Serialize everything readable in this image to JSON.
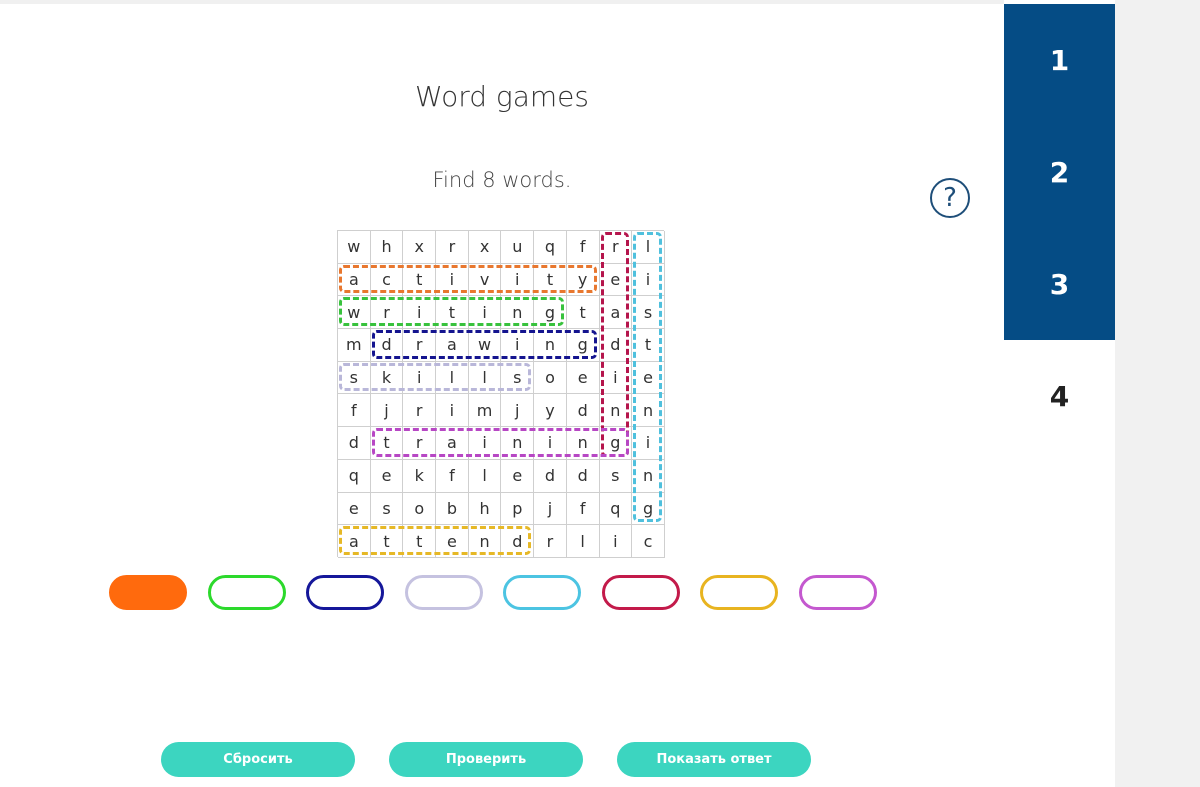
{
  "game": {
    "title": "Word games",
    "instruction": "Find 8 words.",
    "help_symbol": "?"
  },
  "grid": {
    "rows": [
      [
        "w",
        "h",
        "x",
        "r",
        "x",
        "u",
        "q",
        "f",
        "r",
        "l"
      ],
      [
        "a",
        "c",
        "t",
        "i",
        "v",
        "i",
        "t",
        "y",
        "e",
        "i"
      ],
      [
        "w",
        "r",
        "i",
        "t",
        "i",
        "n",
        "g",
        "t",
        "a",
        "s"
      ],
      [
        "m",
        "d",
        "r",
        "a",
        "w",
        "i",
        "n",
        "g",
        "d",
        "t"
      ],
      [
        "s",
        "k",
        "i",
        "l",
        "l",
        "s",
        "o",
        "e",
        "i",
        "e"
      ],
      [
        "f",
        "j",
        "r",
        "i",
        "m",
        "j",
        "y",
        "d",
        "n",
        "n"
      ],
      [
        "d",
        "t",
        "r",
        "a",
        "i",
        "n",
        "i",
        "n",
        "g",
        "i"
      ],
      [
        "q",
        "e",
        "k",
        "f",
        "l",
        "e",
        "d",
        "d",
        "s",
        "n"
      ],
      [
        "e",
        "s",
        "o",
        "b",
        "h",
        "p",
        "j",
        "f",
        "q",
        "g"
      ],
      [
        "a",
        "t",
        "t",
        "e",
        "n",
        "d",
        "r",
        "l",
        "i",
        "c"
      ]
    ]
  },
  "found_words": [
    {
      "word": "activity",
      "color": "#e8772e",
      "row": 1,
      "col": 0,
      "dir": "h",
      "len": 8
    },
    {
      "word": "writing",
      "color": "#38c23d",
      "row": 2,
      "col": 0,
      "dir": "h",
      "len": 7
    },
    {
      "word": "drawing",
      "color": "#14148f",
      "row": 3,
      "col": 1,
      "dir": "h",
      "len": 7
    },
    {
      "word": "skills",
      "color": "#b9b7d9",
      "row": 4,
      "col": 0,
      "dir": "h",
      "len": 6
    },
    {
      "word": "listening",
      "color": "#4fc0dd",
      "row": 0,
      "col": 9,
      "dir": "v",
      "len": 9
    },
    {
      "word": "reading",
      "color": "#b5154c",
      "row": 0,
      "col": 8,
      "dir": "v",
      "len": 7
    },
    {
      "word": "attend",
      "color": "#e6b826",
      "row": 9,
      "col": 0,
      "dir": "h",
      "len": 6
    },
    {
      "word": "training",
      "color": "#b747c4",
      "row": 6,
      "col": 1,
      "dir": "h",
      "len": 8
    }
  ],
  "color_pills": [
    {
      "name": "orange",
      "color": "#ff6a0d",
      "selected": true
    },
    {
      "name": "green",
      "color": "#2cd92c",
      "selected": false
    },
    {
      "name": "navy",
      "color": "#15179a",
      "selected": false
    },
    {
      "name": "lavender",
      "color": "#c5c2e0",
      "selected": false
    },
    {
      "name": "sky",
      "color": "#4cc4e2",
      "selected": false
    },
    {
      "name": "crimson",
      "color": "#c31a4a",
      "selected": false
    },
    {
      "name": "amber",
      "color": "#e8b420",
      "selected": false
    },
    {
      "name": "orchid",
      "color": "#c458cf",
      "selected": false
    }
  ],
  "nav": {
    "items": [
      {
        "label": "1",
        "active": true
      },
      {
        "label": "2",
        "active": true
      },
      {
        "label": "3",
        "active": true
      },
      {
        "label": "4",
        "active": false
      }
    ]
  },
  "actions": {
    "reset_label": "Сбросить",
    "check_label": "Проверить",
    "show_answer_label": "Показать ответ"
  },
  "colors": {
    "nav_active": "#054c85",
    "button": "#3cd5c0"
  }
}
